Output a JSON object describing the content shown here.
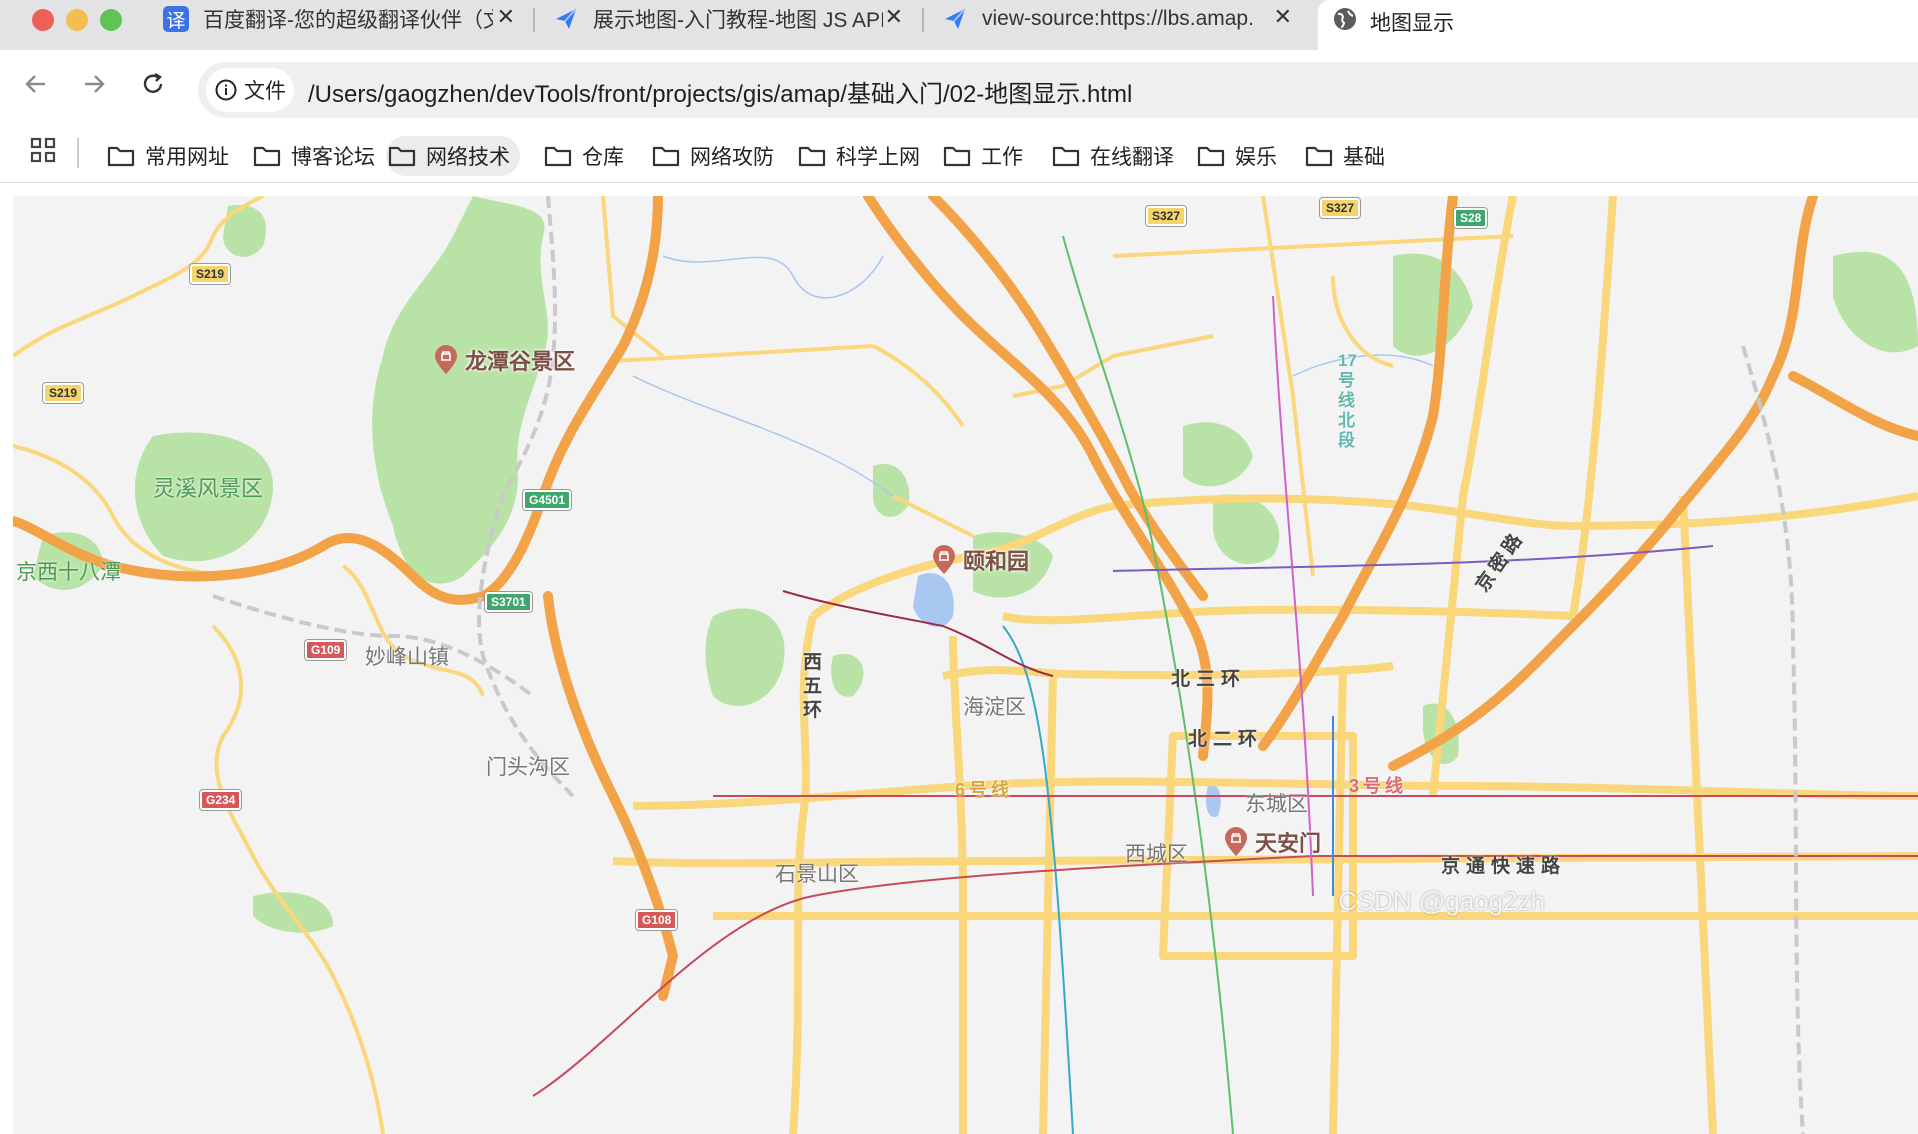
{
  "tabs": [
    {
      "title": "百度翻译-您的超级翻译伙伴（文",
      "icon": "translate-icon",
      "favicon_text": "译",
      "favicon_color": "#3b73e6"
    },
    {
      "title": "展示地图-入门教程-地图 JS API",
      "icon": "amap-paper-plane-icon",
      "favicon_color": "#2f7cf6"
    },
    {
      "title": "view-source:https://lbs.amap.",
      "icon": "amap-paper-plane-icon",
      "favicon_color": "#2f7cf6"
    }
  ],
  "active_tab": {
    "title": "地图显示",
    "icon": "globe-icon"
  },
  "toolbar": {
    "security_chip": "文件",
    "url": "/Users/gaogzhen/devTools/front/projects/gis/amap/基础入门/02-地图显示.html"
  },
  "bookmarks": [
    "常用网址",
    "博客论坛",
    "网络技术",
    "仓库",
    "网络攻防",
    "科学上网",
    "工作",
    "在线翻译",
    "娱乐",
    "基础"
  ],
  "map": {
    "pois": [
      {
        "name": "龙潭谷景区",
        "x": 1.0
      },
      {
        "name": "颐和园",
        "x": 1.0
      },
      {
        "name": "天安门",
        "x": 1.0
      }
    ],
    "scenic_labels": [
      "灵溪风景区",
      "京西十八潭"
    ],
    "district_labels": [
      "妙峰山镇",
      "门头沟区",
      "海淀区",
      "东城区",
      "西城区",
      "石景山区"
    ],
    "road_labels": {
      "west_5th_ring": "西五环",
      "north_3rd_ring": "北三环",
      "north_2nd_ring": "北二环",
      "line_6": "6号线",
      "line_3": "3号线",
      "line_17": "17号线北段",
      "jingtong": "京通快速路",
      "jingmi": "京密路"
    },
    "shields": [
      "S219",
      "S219",
      "G4501",
      "S3701",
      "G109",
      "G234",
      "G108",
      "S327",
      "S327",
      "S28"
    ],
    "watermark": "CSDN @gaog2zh"
  },
  "colors": {
    "tab_strip": "#e3e3e5",
    "omnibox": "#efeff1",
    "map_bg": "#f3f3f4",
    "green": "#b9e3a6",
    "highway": "#f2a348",
    "road": "#fbd77b"
  }
}
